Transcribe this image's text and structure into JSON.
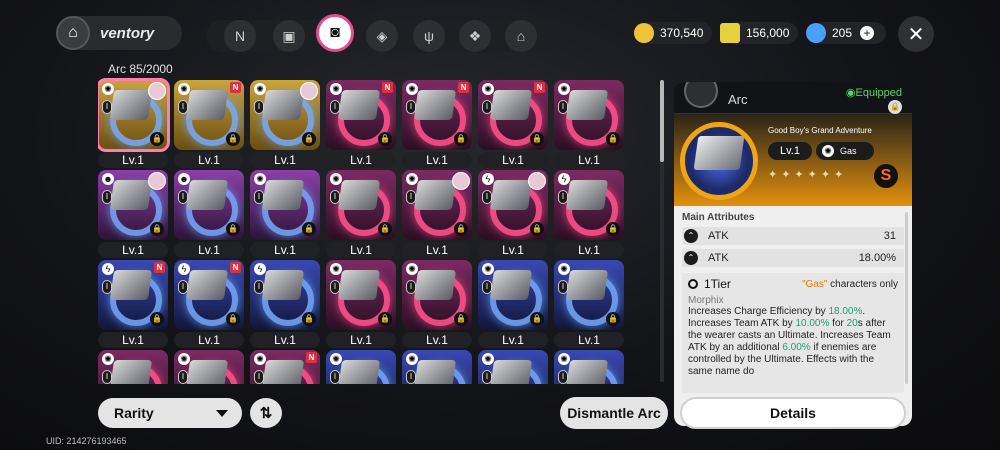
{
  "header": {
    "title": "ventory",
    "nav_tabs": [
      {
        "name": "tab-characters",
        "icon": "N"
      },
      {
        "name": "tab-backpack",
        "icon": "▣"
      },
      {
        "name": "tab-arcs",
        "icon": "◙",
        "active": true
      },
      {
        "name": "tab-items",
        "icon": "◈"
      },
      {
        "name": "tab-food",
        "icon": "ψ"
      },
      {
        "name": "tab-materials",
        "icon": "❖"
      },
      {
        "name": "tab-home",
        "icon": "⌂"
      }
    ],
    "currency": [
      {
        "name": "gold",
        "value": "370,540",
        "color": "#f0c23a"
      },
      {
        "name": "ticket",
        "value": "156,000",
        "color": "#e6d040"
      },
      {
        "name": "crystal",
        "value": "205",
        "color": "#4aa0ff"
      }
    ]
  },
  "grid": {
    "count_label": "Arc  85/2000",
    "items": [
      {
        "level": "Lv.1",
        "rarity": "gold",
        "attr": "✺",
        "new": false,
        "avatar": true,
        "selected": true
      },
      {
        "level": "Lv.1",
        "rarity": "gold",
        "attr": "✺",
        "new": true,
        "avatar": false
      },
      {
        "level": "Lv.1",
        "rarity": "gold",
        "attr": "✺",
        "new": false,
        "avatar": true
      },
      {
        "level": "Lv.1",
        "rarity": "pink",
        "attr": "✺",
        "new": true,
        "avatar": false
      },
      {
        "level": "Lv.1",
        "rarity": "pink",
        "attr": "✺",
        "new": true,
        "avatar": false
      },
      {
        "level": "Lv.1",
        "rarity": "pink",
        "attr": "✺",
        "new": true,
        "avatar": false
      },
      {
        "level": "Lv.1",
        "rarity": "pink",
        "attr": "✺",
        "new": false,
        "avatar": false
      },
      {
        "level": "Lv.1",
        "rarity": "purp",
        "attr": "☻",
        "new": false,
        "avatar": true
      },
      {
        "level": "Lv.1",
        "rarity": "purp",
        "attr": "☻",
        "new": false,
        "avatar": false
      },
      {
        "level": "Lv.1",
        "rarity": "purp",
        "attr": "✺",
        "new": false,
        "avatar": false
      },
      {
        "level": "Lv.1",
        "rarity": "pink",
        "attr": "✺",
        "new": false,
        "avatar": false
      },
      {
        "level": "Lv.1",
        "rarity": "pink",
        "attr": "✺",
        "new": false,
        "avatar": true
      },
      {
        "level": "Lv.1",
        "rarity": "pink",
        "attr": "ϟ",
        "new": false,
        "avatar": true
      },
      {
        "level": "Lv.1",
        "rarity": "pink",
        "attr": "ϟ",
        "new": false,
        "avatar": false
      },
      {
        "level": "Lv.1",
        "rarity": "blue",
        "attr": "ϟ",
        "new": true,
        "avatar": false
      },
      {
        "level": "Lv.1",
        "rarity": "blue",
        "attr": "ϟ",
        "new": true,
        "avatar": false
      },
      {
        "level": "Lv.1",
        "rarity": "blue",
        "attr": "ϟ",
        "new": false,
        "avatar": false
      },
      {
        "level": "Lv.1",
        "rarity": "pink",
        "attr": "✺",
        "new": false,
        "avatar": false
      },
      {
        "level": "Lv.1",
        "rarity": "pink",
        "attr": "✺",
        "new": false,
        "avatar": false
      },
      {
        "level": "Lv.1",
        "rarity": "blue",
        "attr": "✺",
        "new": false,
        "avatar": false
      },
      {
        "level": "Lv.1",
        "rarity": "blue",
        "attr": "✺",
        "new": false,
        "avatar": false
      },
      {
        "level": "",
        "rarity": "pink",
        "attr": "✺",
        "new": false,
        "avatar": false
      },
      {
        "level": "",
        "rarity": "pink",
        "attr": "✺",
        "new": false,
        "avatar": false
      },
      {
        "level": "",
        "rarity": "pink",
        "attr": "✺",
        "new": true,
        "avatar": false
      },
      {
        "level": "",
        "rarity": "blue",
        "attr": "✺",
        "new": false,
        "avatar": false
      },
      {
        "level": "",
        "rarity": "blue",
        "attr": "✺",
        "new": false,
        "avatar": false
      },
      {
        "level": "",
        "rarity": "blue",
        "attr": "✺",
        "new": false,
        "avatar": false
      },
      {
        "level": "",
        "rarity": "blue",
        "attr": "✺",
        "new": false,
        "avatar": false
      }
    ]
  },
  "controls": {
    "rarity_label": "Rarity",
    "sort_icon": "⇅",
    "dismantle_label": "Dismantle Arc",
    "uid": "UID: 214276193465"
  },
  "detail": {
    "name": "Arc",
    "equipped": "◉Equipped",
    "drive_name": "Good Boy's Grand Adventure",
    "level": "Lv.1",
    "element": "Gas",
    "stars": "✦✦✦✦✦✦",
    "rank": "S",
    "main_attributes_label": "Main Attributes",
    "attributes": [
      {
        "name": "ATK",
        "value": "31"
      },
      {
        "name": "ATK",
        "value": "18.00%"
      }
    ],
    "tier_label": "1Tier",
    "gas_quote": "\"Gas\"",
    "characters_only": " characters only",
    "effect_name": "Morphix",
    "desc_1": "Increases Charge Efficiency by ",
    "hl_1": "18.00%",
    "desc_2": ". Increases Team ATK by ",
    "hl_2": "10.00%",
    "desc_3": " for ",
    "hl_3": "20",
    "desc_4": "s after the wearer casts an Ultimate. Increases Team ATK by an additional ",
    "hl_4": "6.00%",
    "desc_5": " if enemies are controlled by the Ultimate. Effects with the same name do",
    "details_label": "Details"
  }
}
